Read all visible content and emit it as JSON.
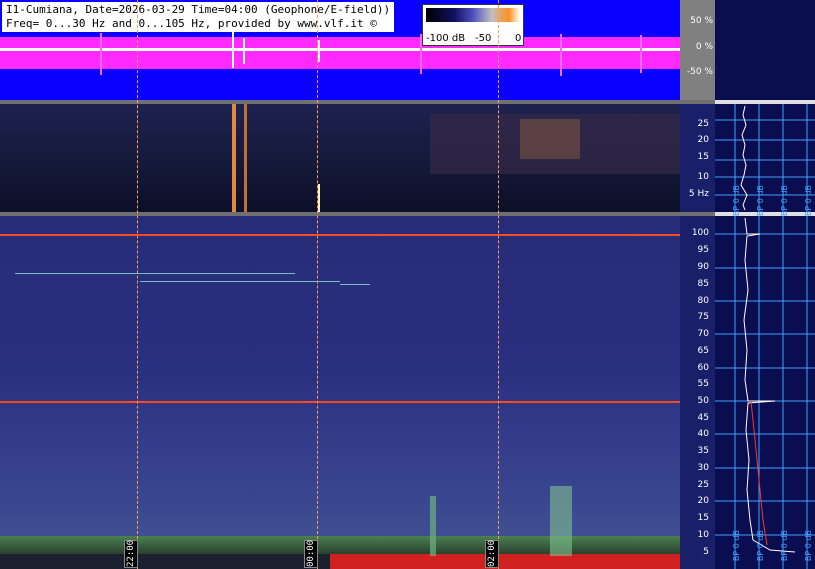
{
  "header": {
    "line1": "I1-Cumiana, Date=2026-03-29 Time=04:00 (Geophone/E-field))",
    "line2": "Freq= 0...30 Hz and 0...105 Hz, provided by www.vlf.it ©"
  },
  "colorbar": {
    "ticks": [
      "-100 dB",
      "-50",
      "0"
    ]
  },
  "waveform_scale": [
    "50 %",
    "0 %",
    "-50 %"
  ],
  "upper_spectrogram": {
    "freq_labels": [
      "25",
      "20",
      "15",
      "10",
      "5 Hz"
    ]
  },
  "lower_spectrogram": {
    "freq_labels": [
      "100",
      "95",
      "90",
      "85",
      "80",
      "75",
      "70",
      "65",
      "60",
      "55",
      "50",
      "45",
      "40",
      "35",
      "30",
      "25",
      "20",
      "15",
      "10",
      "5"
    ]
  },
  "time_markers": [
    "22:00",
    "00:00",
    "02:00"
  ],
  "right_panel": {
    "upper_bp_labels": [
      "BP 0 dB",
      "BP 0 dB",
      "BP 0 dB",
      "BP 0 dB"
    ],
    "lower_bp_labels": [
      "BP 0 dB",
      "BP 0 dB",
      "BP 0 dB",
      "BP 0 dB"
    ]
  },
  "colors": {
    "waveform_bg": "#0a00ff",
    "waveform_band": "#ff2aff",
    "line_50hz": "#ff4a20",
    "line_100hz": "#ff4a20",
    "time_grid": "#ff9a5a",
    "scale_grid": "#3fa0ff"
  }
}
